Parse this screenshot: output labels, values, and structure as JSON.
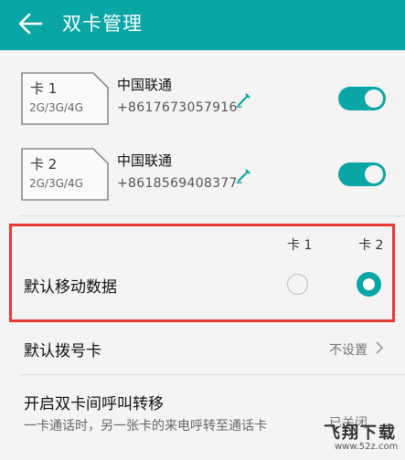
{
  "app_bar": {
    "title": "双卡管理"
  },
  "sims": [
    {
      "slot": "卡 1",
      "bands": "2G/3G/4G",
      "carrier": "中国联通",
      "phone": "+8617673057916",
      "enabled": true
    },
    {
      "slot": "卡 2",
      "bands": "2G/3G/4G",
      "carrier": "中国联通",
      "phone": "+8618569408377",
      "enabled": true
    }
  ],
  "default_data": {
    "column_labels": [
      "卡 1",
      "卡 2"
    ],
    "label": "默认移动数据",
    "selected": "卡 2"
  },
  "default_dial": {
    "label": "默认拨号卡",
    "value": "不设置"
  },
  "call_forward": {
    "label": "开启双卡间呼叫转移",
    "description": "一卡通话时，另一张卡的来电呼转至通话卡",
    "value": "已关闭"
  },
  "watermark": {
    "title": "飞翔下载",
    "url": "www.52z.com"
  },
  "colors": {
    "accent": "#0aa5a5",
    "highlight": "#e53935"
  }
}
